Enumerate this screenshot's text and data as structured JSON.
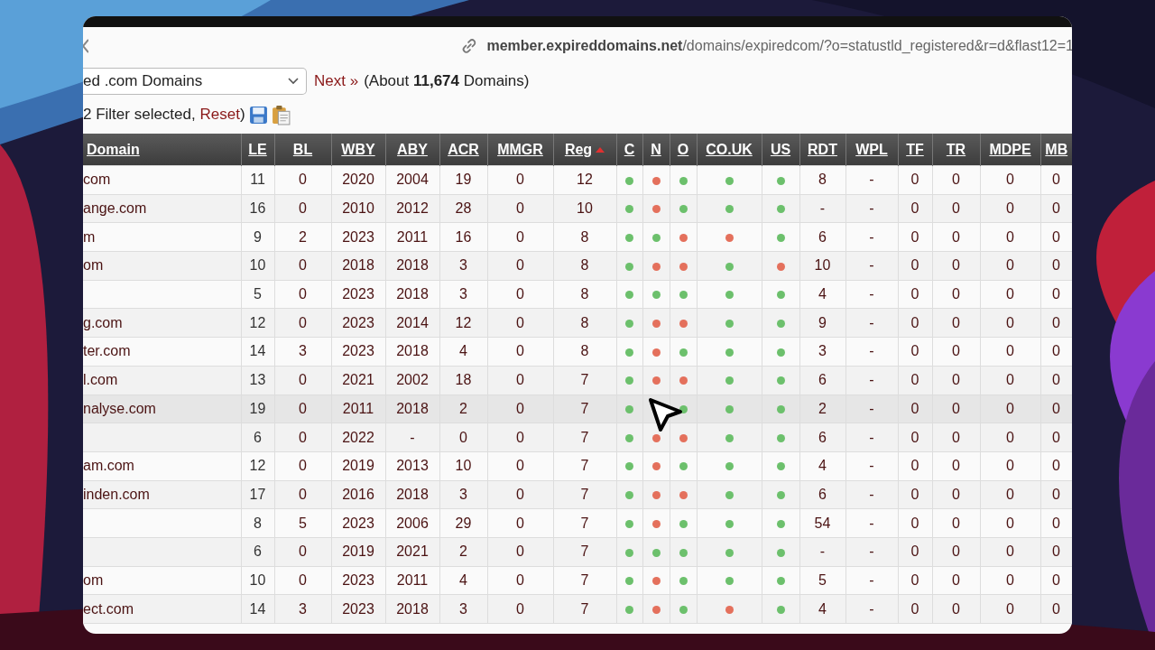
{
  "address_bar": {
    "url": "**member.expireddomains.net**/domains/expiredcom/?o=statustld_registered&r=d&flast12=1"
  },
  "toolbar": {
    "list_select": "ed .com Domains",
    "next": "Next »",
    "count": "(About **11,674** Domains)"
  },
  "filter": {
    "summary": "2 Filter selected, ",
    "reset": "Reset",
    "close": ")"
  },
  "table": {
    "columns": [
      {
        "label": "Domain",
        "kind": "domain",
        "sorted": false
      },
      {
        "label": "LE",
        "kind": "text",
        "sorted": false
      },
      {
        "label": "BL",
        "kind": "text",
        "sorted": false
      },
      {
        "label": "WBY",
        "kind": "text",
        "sorted": false
      },
      {
        "label": "ABY",
        "kind": "text",
        "sorted": false
      },
      {
        "label": "ACR",
        "kind": "text",
        "sorted": false
      },
      {
        "label": "MMGR",
        "kind": "text",
        "sorted": false
      },
      {
        "label": "Reg",
        "kind": "text",
        "sorted": true
      },
      {
        "label": "C",
        "kind": "dot",
        "sorted": false
      },
      {
        "label": "N",
        "kind": "dot",
        "sorted": false
      },
      {
        "label": "O",
        "kind": "dot",
        "sorted": false
      },
      {
        "label": "CO.UK",
        "kind": "dot",
        "sorted": false
      },
      {
        "label": "US",
        "kind": "dot",
        "sorted": false
      },
      {
        "label": "RDT",
        "kind": "text",
        "sorted": false
      },
      {
        "label": "WPL",
        "kind": "text",
        "sorted": false
      },
      {
        "label": "TF",
        "kind": "text",
        "sorted": false
      },
      {
        "label": "TR",
        "kind": "text",
        "sorted": false
      },
      {
        "label": "MDPE",
        "kind": "text",
        "sorted": false
      },
      {
        "label": "MB",
        "kind": "text",
        "sorted": false
      }
    ],
    "rows": [
      {
        "highlighted": false,
        "cells": [
          "com",
          "11",
          "0",
          "2020",
          "2004",
          "19",
          "0",
          "12",
          true,
          false,
          true,
          true,
          true,
          "8",
          "-",
          "0",
          "0",
          "0",
          "0"
        ]
      },
      {
        "highlighted": false,
        "cells": [
          "ange.com",
          "16",
          "0",
          "2010",
          "2012",
          "28",
          "0",
          "10",
          true,
          false,
          true,
          true,
          true,
          "-",
          "-",
          "0",
          "0",
          "0",
          "0"
        ]
      },
      {
        "highlighted": false,
        "cells": [
          "m",
          "9",
          "2",
          "2023",
          "2011",
          "16",
          "0",
          "8",
          true,
          true,
          false,
          false,
          true,
          "6",
          "-",
          "0",
          "0",
          "0",
          "0"
        ]
      },
      {
        "highlighted": false,
        "cells": [
          "om",
          "10",
          "0",
          "2018",
          "2018",
          "3",
          "0",
          "8",
          true,
          false,
          false,
          true,
          false,
          "10",
          "-",
          "0",
          "0",
          "0",
          "0"
        ]
      },
      {
        "highlighted": false,
        "cells": [
          null,
          "5",
          "0",
          "2023",
          "2018",
          "3",
          "0",
          "8",
          true,
          true,
          true,
          true,
          true,
          "4",
          "-",
          "0",
          "0",
          "0",
          "0"
        ]
      },
      {
        "highlighted": false,
        "cells": [
          "g.com",
          "12",
          "0",
          "2023",
          "2014",
          "12",
          "0",
          "8",
          true,
          false,
          false,
          true,
          true,
          "9",
          "-",
          "0",
          "0",
          "0",
          "0"
        ]
      },
      {
        "highlighted": false,
        "cells": [
          "ter.com",
          "14",
          "3",
          "2023",
          "2018",
          "4",
          "0",
          "8",
          true,
          false,
          true,
          true,
          true,
          "3",
          "-",
          "0",
          "0",
          "0",
          "0"
        ]
      },
      {
        "highlighted": false,
        "cells": [
          "l.com",
          "13",
          "0",
          "2021",
          "2002",
          "18",
          "0",
          "7",
          true,
          false,
          false,
          true,
          true,
          "6",
          "-",
          "0",
          "0",
          "0",
          "0"
        ]
      },
      {
        "highlighted": true,
        "cells": [
          "nalyse.com",
          "19",
          "0",
          "2011",
          "2018",
          "2",
          "0",
          "7",
          true,
          null,
          true,
          true,
          true,
          "2",
          "-",
          "0",
          "0",
          "0",
          "0"
        ]
      },
      {
        "highlighted": false,
        "cells": [
          null,
          "6",
          "0",
          "2022",
          "-",
          "0",
          "0",
          "7",
          true,
          false,
          false,
          true,
          true,
          "6",
          "-",
          "0",
          "0",
          "0",
          "0"
        ]
      },
      {
        "highlighted": false,
        "cells": [
          "am.com",
          "12",
          "0",
          "2019",
          "2013",
          "10",
          "0",
          "7",
          true,
          false,
          true,
          true,
          true,
          "4",
          "-",
          "0",
          "0",
          "0",
          "0"
        ]
      },
      {
        "highlighted": false,
        "cells": [
          "inden.com",
          "17",
          "0",
          "2016",
          "2018",
          "3",
          "0",
          "7",
          true,
          false,
          false,
          true,
          true,
          "6",
          "-",
          "0",
          "0",
          "0",
          "0"
        ]
      },
      {
        "highlighted": false,
        "cells": [
          null,
          "8",
          "5",
          "2023",
          "2006",
          "29",
          "0",
          "7",
          true,
          false,
          true,
          true,
          true,
          "54",
          "-",
          "0",
          "0",
          "0",
          "0"
        ]
      },
      {
        "highlighted": false,
        "cells": [
          null,
          "6",
          "0",
          "2019",
          "2021",
          "2",
          "0",
          "7",
          true,
          true,
          true,
          true,
          true,
          "-",
          "-",
          "0",
          "0",
          "0",
          "0"
        ]
      },
      {
        "highlighted": false,
        "cells": [
          "om",
          "10",
          "0",
          "2023",
          "2011",
          "4",
          "0",
          "7",
          true,
          false,
          true,
          true,
          true,
          "5",
          "-",
          "0",
          "0",
          "0",
          "0"
        ]
      },
      {
        "highlighted": false,
        "cells": [
          "ect.com",
          "14",
          "3",
          "2023",
          "2018",
          "3",
          "0",
          "7",
          true,
          false,
          true,
          false,
          true,
          "4",
          "-",
          "0",
          "0",
          "0",
          "0"
        ]
      }
    ]
  }
}
